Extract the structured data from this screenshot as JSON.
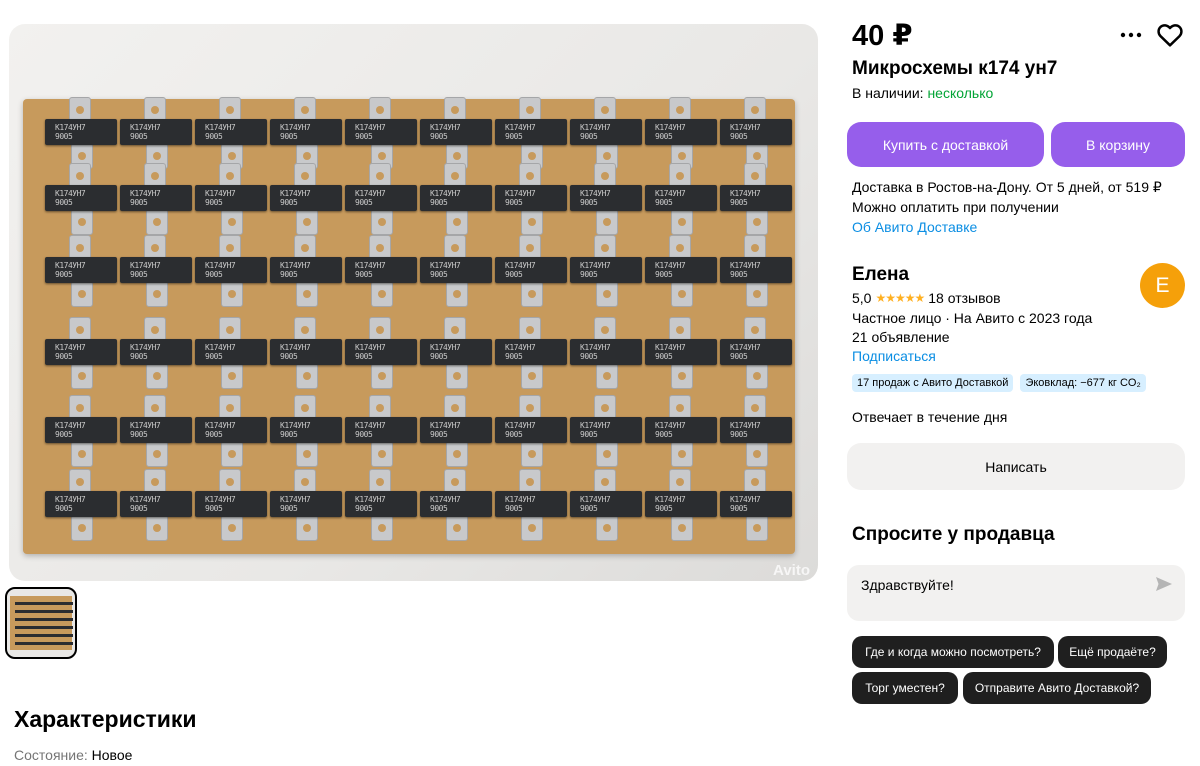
{
  "gallery": {
    "main_photo_alt": "Микросхемы к174 ун7",
    "chip_marking": "К174УН7",
    "chip_code": "9005",
    "watermark": "Avito"
  },
  "listing": {
    "price": "40 ₽",
    "title": "Микросхемы к174 ун7",
    "availability_label": "В наличии:",
    "availability_value": "несколько"
  },
  "actions": {
    "buy_with_delivery": "Купить с доставкой",
    "add_to_cart": "В корзину",
    "more_icon": "more-dots-icon",
    "favorite_icon": "heart-icon"
  },
  "delivery": {
    "line1": "Доставка в Ростов-на-Дону. От 5 дней, от 519 ₽",
    "line2": "Можно оплатить при получении",
    "link": "Об Авито Доставке"
  },
  "seller": {
    "name": "Елена",
    "avatar_letter": "Е",
    "rating": "5,0",
    "stars": "★★★★★",
    "reviews": "18 отзывов",
    "type": "Частное лицо · На Авито с 2023 года",
    "ads_count": "21 объявление",
    "subscribe": "Подписаться",
    "badges": [
      "17 продаж с Авито Доставкой",
      "Эковклад: −677 кг CO₂"
    ],
    "response_time": "Отвечает в течение дня",
    "write_button": "Написать"
  },
  "ask": {
    "title": "Спросите у продавца",
    "message": "Здравствуйте!",
    "quick_questions": [
      "Где и когда можно посмотреть?",
      "Ещё продаёте?",
      "Торг уместен?",
      "Отправите Авито Доставкой?"
    ]
  },
  "characteristics": {
    "title": "Характеристики",
    "condition_label": "Состояние:",
    "condition_value": "Новое"
  },
  "colors": {
    "accent": "#965eeb",
    "link": "#0b8ee3",
    "available": "#02a435",
    "avatar": "#f5a00a",
    "badge": "#d7efff"
  }
}
